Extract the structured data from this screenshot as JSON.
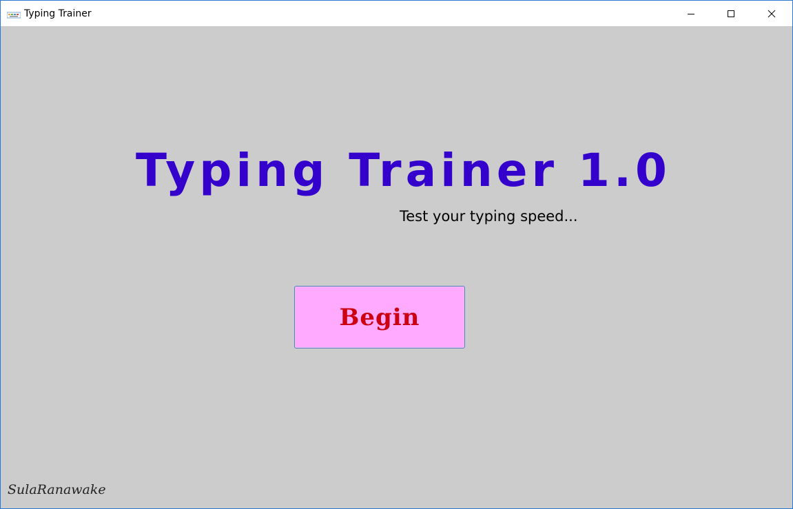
{
  "window": {
    "title": "Typing Trainer",
    "icon": "typing-trainer-app-icon",
    "controls": [
      "minimize",
      "maximize",
      "close"
    ]
  },
  "main": {
    "title": "Typing Trainer 1.0",
    "subtitle": "Test your typing speed...",
    "begin_label": "Begin",
    "signature": "SulaRanawake"
  },
  "colors": {
    "background": "#cccccc",
    "title": "#3300cc",
    "button_fill": "#ffaaff",
    "button_text": "#cc0011"
  }
}
